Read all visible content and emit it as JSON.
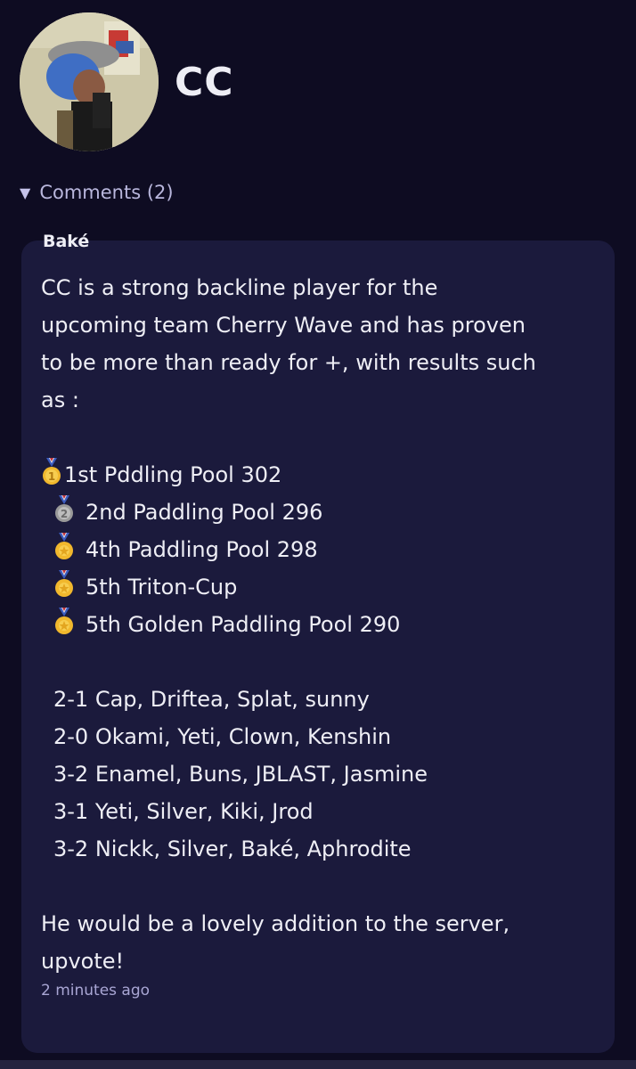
{
  "profile": {
    "username": "CC"
  },
  "comments": {
    "toggle_label": "Comments (2)"
  },
  "comment": {
    "author": "Baké",
    "intro": [
      "CC is a strong backline player for the",
      "upcoming team Cherry Wave and has proven",
      "to be more than ready for +, with results such",
      "as :"
    ],
    "placements": [
      {
        "medal": "gold",
        "text": "1st Pddling Pool 302"
      },
      {
        "medal": "silver",
        "text": "2nd Paddling Pool 296"
      },
      {
        "medal": "sports",
        "text": "4th Paddling Pool 298"
      },
      {
        "medal": "sports",
        "text": "5th Triton-Cup"
      },
      {
        "medal": "sports",
        "text": "5th Golden Paddling Pool 290"
      }
    ],
    "wins": [
      "2-1 Cap, Driftea, Splat, sunny",
      "2-0 Okami, Yeti, Clown, Kenshin",
      "3-2 Enamel, Buns, JBLAST, Jasmine",
      "3-1 Yeti, Silver, Kiki, Jrod",
      "3-2 Nickk, Silver, Baké, Aphrodite"
    ],
    "closing": [
      "He would be a lovely addition to the server,",
      "upvote!"
    ],
    "timestamp": "2 minutes ago"
  },
  "icons": {
    "caret": "triangle-down-icon",
    "medal_gold": "gold-medal-icon",
    "medal_silver": "silver-medal-icon",
    "medal_sports": "sports-medal-icon"
  },
  "colors": {
    "background": "#0e0c22",
    "card": "#1b1a3c",
    "link": "#b9b7dd",
    "timestamp": "#a9a6d4"
  }
}
